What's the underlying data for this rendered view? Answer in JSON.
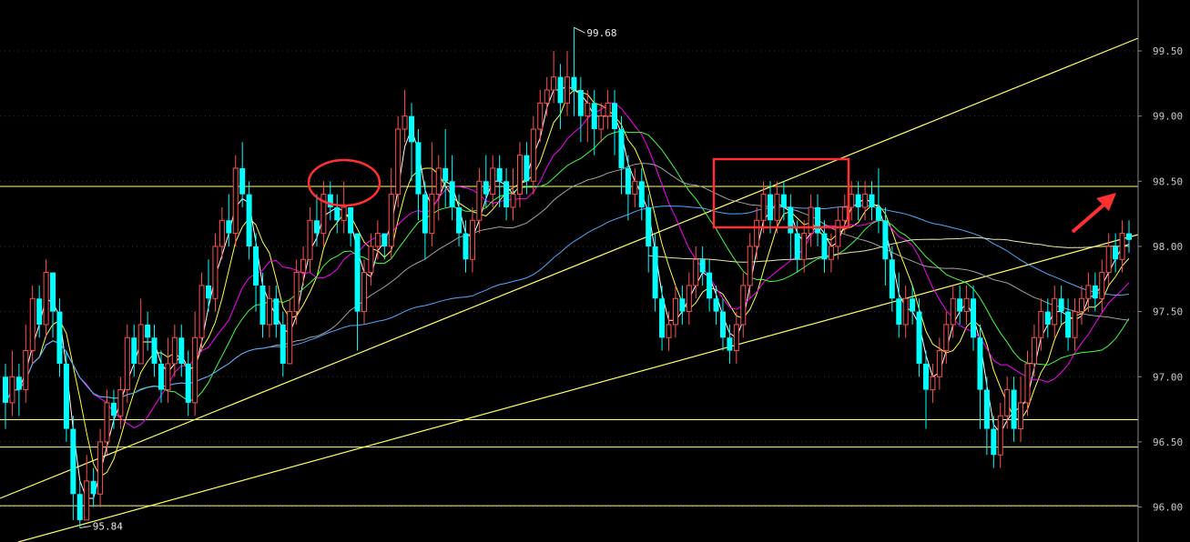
{
  "chart_data": {
    "type": "candlestick",
    "y_axis": {
      "ticks": [
        "99.50",
        "99.00",
        "98.50",
        "98.00",
        "97.50",
        "97.00",
        "96.50",
        "96.00"
      ],
      "range": [
        95.75,
        99.85
      ],
      "position": "right"
    },
    "extremes": {
      "high": {
        "value": 99.68,
        "label": "99.68"
      },
      "low": {
        "value": 95.84,
        "label": "95.84"
      }
    },
    "colors": {
      "background": "#000000",
      "up_candle": "#ff5050",
      "down_candle": "#00ffff",
      "horizontal_lines": "#ffff80",
      "trendlines": "#ffff60",
      "annotation": "#ff3030",
      "ma_white": "#ffffff",
      "ma_yellow": "#ffff40",
      "ma_magenta": "#ff00ff",
      "ma_green": "#40ff40",
      "ma_grey": "#a0a0a0",
      "ma_blue": "#4fa8ff"
    },
    "horizontal_levels": [
      98.46,
      96.67,
      96.46,
      96.01
    ],
    "candles": [
      [
        97.0,
        96.8,
        97.1,
        96.6
      ],
      [
        96.8,
        97.0,
        97.2,
        96.7
      ],
      [
        97.0,
        96.9,
        97.1,
        96.7
      ],
      [
        96.9,
        97.2,
        97.4,
        96.8
      ],
      [
        97.2,
        97.6,
        97.7,
        97.1
      ],
      [
        97.6,
        97.4,
        97.7,
        97.3
      ],
      [
        97.4,
        97.8,
        97.9,
        97.3
      ],
      [
        97.8,
        97.5,
        97.8,
        97.3
      ],
      [
        97.5,
        97.1,
        97.6,
        97.0
      ],
      [
        97.1,
        96.6,
        97.2,
        96.5
      ],
      [
        96.6,
        96.1,
        96.7,
        95.9
      ],
      [
        96.1,
        95.9,
        96.2,
        95.84
      ],
      [
        95.9,
        96.2,
        96.4,
        95.9
      ],
      [
        96.2,
        96.1,
        96.3,
        96.0
      ],
      [
        96.1,
        96.5,
        96.6,
        96.0
      ],
      [
        96.5,
        96.8,
        96.9,
        96.4
      ],
      [
        96.8,
        96.7,
        96.9,
        96.6
      ],
      [
        96.7,
        96.9,
        97.0,
        96.6
      ],
      [
        96.9,
        97.3,
        97.4,
        96.8
      ],
      [
        97.3,
        97.1,
        97.4,
        97.0
      ],
      [
        97.1,
        97.4,
        97.6,
        97.1
      ],
      [
        97.4,
        97.3,
        97.5,
        97.2
      ],
      [
        97.3,
        97.1,
        97.4,
        97.0
      ],
      [
        97.1,
        96.9,
        97.2,
        96.8
      ],
      [
        96.9,
        97.1,
        97.3,
        96.8
      ],
      [
        97.1,
        97.3,
        97.4,
        97.0
      ],
      [
        97.3,
        97.1,
        97.4,
        97.0
      ],
      [
        97.1,
        96.8,
        97.2,
        96.7
      ],
      [
        96.8,
        97.3,
        97.5,
        96.7
      ],
      [
        97.3,
        97.7,
        97.8,
        97.2
      ],
      [
        97.7,
        97.6,
        97.9,
        97.5
      ],
      [
        97.6,
        98.0,
        98.1,
        97.5
      ],
      [
        98.0,
        98.2,
        98.3,
        97.9
      ],
      [
        98.2,
        98.1,
        98.4,
        98.0
      ],
      [
        98.1,
        98.6,
        98.7,
        98.0
      ],
      [
        98.6,
        98.4,
        98.8,
        98.3
      ],
      [
        98.4,
        98.0,
        98.5,
        97.9
      ],
      [
        98.0,
        97.7,
        98.1,
        97.5
      ],
      [
        97.7,
        97.4,
        97.8,
        97.3
      ],
      [
        97.4,
        97.6,
        97.7,
        97.3
      ],
      [
        97.6,
        97.4,
        97.7,
        97.3
      ],
      [
        97.4,
        97.1,
        97.5,
        97.0
      ],
      [
        97.1,
        97.5,
        97.6,
        97.1
      ],
      [
        97.5,
        97.8,
        97.9,
        97.4
      ],
      [
        97.8,
        97.9,
        98.0,
        97.7
      ],
      [
        97.9,
        98.2,
        98.3,
        97.8
      ],
      [
        98.2,
        98.1,
        98.4,
        98.0
      ],
      [
        98.1,
        98.4,
        98.5,
        98.0
      ],
      [
        98.4,
        98.3,
        98.5,
        98.2
      ],
      [
        98.3,
        98.2,
        98.4,
        98.1
      ],
      [
        98.2,
        98.3,
        98.5,
        98.1
      ],
      [
        98.3,
        98.1,
        98.3,
        98.0
      ],
      [
        98.1,
        97.5,
        98.1,
        97.2
      ],
      [
        97.5,
        97.8,
        97.9,
        97.4
      ],
      [
        97.8,
        98.0,
        98.1,
        97.7
      ],
      [
        98.0,
        98.1,
        98.2,
        97.9
      ],
      [
        98.1,
        98.0,
        98.1,
        97.9
      ],
      [
        98.0,
        98.4,
        98.6,
        97.9
      ],
      [
        98.4,
        98.9,
        99.0,
        98.3
      ],
      [
        98.9,
        99.0,
        99.2,
        98.8
      ],
      [
        99.0,
        98.8,
        99.1,
        98.5
      ],
      [
        98.8,
        98.4,
        98.9,
        98.2
      ],
      [
        98.4,
        98.1,
        98.5,
        97.9
      ],
      [
        98.1,
        98.4,
        98.8,
        98.0
      ],
      [
        98.4,
        98.6,
        98.7,
        98.2
      ],
      [
        98.6,
        98.5,
        98.9,
        98.3
      ],
      [
        98.5,
        98.3,
        98.7,
        98.2
      ],
      [
        98.3,
        98.1,
        98.4,
        98.0
      ],
      [
        98.1,
        97.9,
        98.2,
        97.8
      ],
      [
        97.9,
        98.2,
        98.3,
        97.8
      ],
      [
        98.2,
        98.5,
        98.6,
        98.1
      ],
      [
        98.5,
        98.4,
        98.7,
        98.3
      ],
      [
        98.4,
        98.6,
        98.7,
        98.3
      ],
      [
        98.6,
        98.5,
        98.7,
        98.3
      ],
      [
        98.5,
        98.3,
        98.6,
        98.2
      ],
      [
        98.3,
        98.4,
        98.6,
        98.2
      ],
      [
        98.4,
        98.7,
        98.8,
        98.3
      ],
      [
        98.7,
        98.5,
        98.8,
        98.4
      ],
      [
        98.5,
        98.9,
        99.0,
        98.4
      ],
      [
        98.9,
        99.1,
        99.2,
        98.8
      ],
      [
        99.1,
        99.2,
        99.3,
        99.0
      ],
      [
        99.2,
        99.3,
        99.5,
        99.1
      ],
      [
        99.3,
        99.1,
        99.4,
        98.9
      ],
      [
        99.1,
        99.3,
        99.5,
        99.0
      ],
      [
        99.3,
        99.2,
        99.68,
        99.0
      ],
      [
        99.2,
        99.0,
        99.3,
        98.8
      ],
      [
        99.0,
        99.1,
        99.2,
        98.8
      ],
      [
        99.1,
        98.9,
        99.2,
        98.7
      ],
      [
        98.9,
        99.0,
        99.1,
        98.8
      ],
      [
        99.0,
        99.1,
        99.2,
        98.9
      ],
      [
        99.1,
        98.9,
        99.2,
        98.7
      ],
      [
        98.9,
        98.6,
        99.0,
        98.4
      ],
      [
        98.6,
        98.4,
        98.7,
        98.2
      ],
      [
        98.4,
        98.5,
        98.6,
        98.3
      ],
      [
        98.5,
        98.3,
        98.6,
        98.2
      ],
      [
        98.3,
        98.0,
        98.4,
        97.8
      ],
      [
        98.0,
        97.6,
        98.1,
        97.5
      ],
      [
        97.6,
        97.3,
        97.7,
        97.2
      ],
      [
        97.3,
        97.4,
        97.5,
        97.2
      ],
      [
        97.4,
        97.6,
        97.7,
        97.3
      ],
      [
        97.6,
        97.5,
        97.7,
        97.4
      ],
      [
        97.5,
        97.7,
        97.8,
        97.4
      ],
      [
        97.7,
        97.9,
        98.0,
        97.6
      ],
      [
        97.9,
        97.8,
        98.0,
        97.7
      ],
      [
        97.8,
        97.6,
        97.9,
        97.5
      ],
      [
        97.6,
        97.5,
        97.7,
        97.4
      ],
      [
        97.5,
        97.3,
        97.6,
        97.2
      ],
      [
        97.3,
        97.2,
        97.4,
        97.1
      ],
      [
        97.2,
        97.4,
        97.5,
        97.1
      ],
      [
        97.4,
        97.7,
        97.8,
        97.3
      ],
      [
        97.7,
        98.0,
        98.1,
        97.6
      ],
      [
        98.0,
        98.2,
        98.3,
        97.9
      ],
      [
        98.2,
        98.4,
        98.5,
        98.1
      ],
      [
        98.4,
        98.2,
        98.5,
        98.1
      ],
      [
        98.2,
        98.4,
        98.5,
        98.1
      ],
      [
        98.4,
        98.3,
        98.5,
        98.2
      ],
      [
        98.3,
        98.1,
        98.4,
        97.9
      ],
      [
        98.1,
        97.9,
        98.2,
        97.8
      ],
      [
        97.9,
        98.1,
        98.2,
        97.8
      ],
      [
        98.1,
        98.3,
        98.4,
        98.0
      ],
      [
        98.3,
        98.1,
        98.4,
        98.0
      ],
      [
        98.1,
        97.9,
        98.2,
        97.8
      ],
      [
        97.9,
        98.0,
        98.1,
        97.8
      ],
      [
        98.0,
        98.2,
        98.3,
        97.9
      ],
      [
        98.2,
        98.3,
        98.4,
        98.1
      ],
      [
        98.3,
        98.4,
        98.5,
        98.2
      ],
      [
        98.4,
        98.3,
        98.5,
        98.2
      ],
      [
        98.3,
        98.4,
        98.5,
        98.2
      ],
      [
        98.4,
        98.3,
        98.5,
        98.2
      ],
      [
        98.3,
        98.2,
        98.6,
        98.1
      ],
      [
        98.2,
        97.9,
        98.3,
        97.7
      ],
      [
        97.9,
        97.6,
        98.0,
        97.5
      ],
      [
        97.6,
        97.4,
        97.8,
        97.3
      ],
      [
        97.4,
        97.6,
        97.7,
        97.3
      ],
      [
        97.6,
        97.5,
        97.7,
        97.4
      ],
      [
        97.5,
        97.1,
        97.6,
        97.0
      ],
      [
        97.1,
        96.9,
        97.2,
        96.6
      ],
      [
        96.9,
        97.0,
        97.1,
        96.8
      ],
      [
        97.0,
        97.2,
        97.3,
        96.9
      ],
      [
        97.2,
        97.4,
        97.5,
        97.1
      ],
      [
        97.4,
        97.6,
        97.7,
        97.3
      ],
      [
        97.6,
        97.5,
        97.7,
        97.4
      ],
      [
        97.5,
        97.6,
        97.7,
        97.4
      ],
      [
        97.6,
        97.3,
        97.7,
        97.2
      ],
      [
        97.3,
        96.9,
        97.4,
        96.6
      ],
      [
        96.9,
        96.6,
        97.0,
        96.4
      ],
      [
        96.6,
        96.4,
        96.7,
        96.3
      ],
      [
        96.4,
        96.7,
        96.8,
        96.3
      ],
      [
        96.7,
        96.9,
        97.0,
        96.6
      ],
      [
        96.9,
        96.6,
        97.0,
        96.5
      ],
      [
        96.6,
        96.8,
        97.0,
        96.5
      ],
      [
        96.8,
        97.1,
        97.2,
        96.7
      ],
      [
        97.1,
        97.3,
        97.4,
        97.0
      ],
      [
        97.3,
        97.5,
        97.6,
        97.2
      ],
      [
        97.5,
        97.4,
        97.6,
        97.3
      ],
      [
        97.4,
        97.6,
        97.7,
        97.3
      ],
      [
        97.6,
        97.5,
        97.7,
        97.4
      ],
      [
        97.5,
        97.3,
        97.6,
        97.2
      ],
      [
        97.3,
        97.5,
        97.6,
        97.2
      ],
      [
        97.5,
        97.6,
        97.7,
        97.4
      ],
      [
        97.6,
        97.7,
        97.8,
        97.5
      ],
      [
        97.7,
        97.6,
        97.8,
        97.5
      ],
      [
        97.6,
        97.8,
        97.9,
        97.5
      ],
      [
        97.8,
        98.0,
        98.1,
        97.7
      ],
      [
        98.0,
        97.9,
        98.1,
        97.8
      ],
      [
        97.9,
        98.1,
        98.2,
        97.8
      ],
      [
        98.1,
        98.05,
        98.2,
        97.95
      ]
    ]
  }
}
